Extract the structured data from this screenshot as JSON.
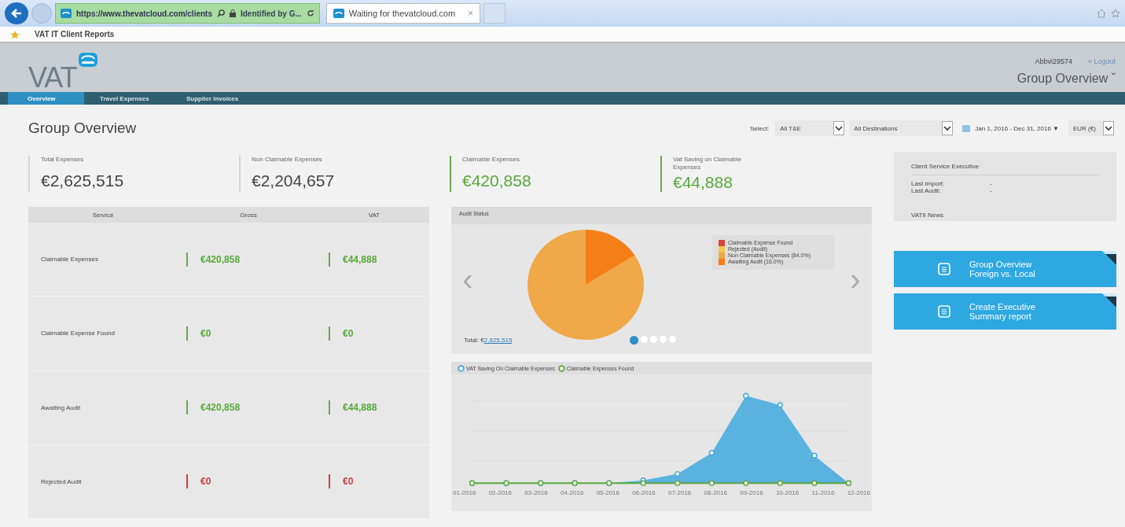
{
  "browser": {
    "address": "https://www.thevatcloud.com/clients",
    "identity": "Identified by G...",
    "tab": "Waiting for thevatcloud.com",
    "tab_close": "×",
    "favorite": "VAT IT Client Reports"
  },
  "header": {
    "logo": "VAT",
    "user": "Abbvi29574",
    "logout": "» Logout",
    "view_menu": "Group Overview ˇ"
  },
  "nav": [
    {
      "label": "Overview",
      "selected": true
    },
    {
      "label": "Travel Expenses",
      "selected": false
    },
    {
      "label": "Supplier Invoices",
      "selected": false
    }
  ],
  "page_title": "Group Overview",
  "filters": {
    "label": "Select:",
    "items": [
      {
        "kind": "dropdown",
        "value": "All T&E"
      },
      {
        "kind": "dropdown",
        "value": "All Destinations"
      },
      {
        "kind": "date",
        "value": "Jan 1, 2016 - Dec 31, 2016 ▼"
      },
      {
        "kind": "dropdown",
        "value": "EUR (€)"
      }
    ]
  },
  "kpis": [
    {
      "label": "Total Expenses",
      "value": "€2,625,515",
      "kind": "neutral"
    },
    {
      "label": "Non Claimable Expenses",
      "value": "€2,204,657",
      "kind": "neutral"
    },
    {
      "label": "Claimable Expenses",
      "value": "€420,858",
      "kind": "positive"
    },
    {
      "label": "Vat Saving on Claimable Expenses",
      "value": "€44,888",
      "kind": "positive"
    }
  ],
  "table": {
    "columns": [
      "Service",
      "Gross",
      "VAT"
    ],
    "rows": [
      {
        "service": "Claimable Expenses",
        "gross": "€420,858",
        "vat": "€44,888",
        "kind": "positive"
      },
      {
        "service": "Claimable Expense Found",
        "gross": "€0",
        "vat": "€0",
        "kind": "positive"
      },
      {
        "service": "Awaiting Audit",
        "gross": "€420,858",
        "vat": "€44,888",
        "kind": "positive"
      },
      {
        "service": "Rejected Audit",
        "gross": "€0",
        "vat": "€0",
        "kind": "negative"
      }
    ]
  },
  "audit_status": {
    "title": "Audit Status",
    "prev": "‹",
    "next": "›",
    "total_label": "Total: €",
    "total_link": "2,625,515",
    "chart_data": {
      "type": "pie",
      "categories": [
        "Claimable Expense Found",
        "Rejected (Audit)",
        "Non Claimable Expenses (84.0%)",
        "Awaiting Audit (16.0%)"
      ],
      "values": [
        0,
        0,
        84,
        16
      ],
      "colors": [
        "#d9453a",
        "#f2c84b",
        "#f0a848",
        "#f57f17"
      ]
    },
    "pages": [
      {
        "selected": true
      },
      {
        "selected": false
      },
      {
        "selected": false
      },
      {
        "selected": false
      },
      {
        "selected": false
      }
    ]
  },
  "trend": {
    "legend": [
      {
        "label": "VAT Saving On Claimable Expenses",
        "color": "#3fa9dc"
      },
      {
        "label": "Claimable Expenses Found",
        "color": "#5aa83c"
      }
    ],
    "x_labels": [
      "01-2016",
      "02-2016",
      "03-2016",
      "04-2016",
      "05-2016",
      "06-2016",
      "07-2016",
      "08-2016",
      "09-2016",
      "10-2016",
      "11-2016",
      "12-2016"
    ]
  },
  "side": {
    "title": "Client Service Executive",
    "fields": [
      {
        "label": "Last Import:",
        "value": "-"
      },
      {
        "label": "Last Audit:",
        "value": "-"
      }
    ],
    "news": "VATII News",
    "actions": [
      "Group Overview Foreign vs. Local",
      "Create Executive Summary report"
    ]
  }
}
